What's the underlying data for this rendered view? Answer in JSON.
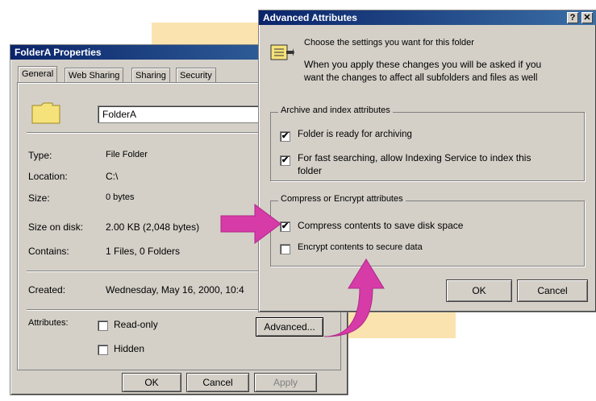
{
  "colors": {
    "arrow": "#d63ba8",
    "highlight_band": "#fbe3b0",
    "titlebar": "#0a246a"
  },
  "props": {
    "title": "FolderA Properties",
    "tabs": [
      "General",
      "Web Sharing",
      "Sharing",
      "Security"
    ],
    "folder_icon": "folder-icon",
    "name_value": "FolderA",
    "rows": [
      {
        "label": "Type:",
        "value": "File Folder"
      },
      {
        "label": "Location:",
        "value": "C:\\"
      },
      {
        "label": "Size:",
        "value": "0 bytes"
      },
      {
        "label": "Size on disk:",
        "value": "2.00 KB (2,048 bytes)"
      },
      {
        "label": "Contains:",
        "value": "1 Files, 0 Folders"
      }
    ],
    "created_label": "Created:",
    "created_value": "Wednesday, May 16, 2000, 10:4",
    "attributes_label": "Attributes:",
    "readonly_label": "Read-only",
    "hidden_label": "Hidden",
    "advanced_button": "Advanced...",
    "ok": "OK",
    "cancel": "Cancel",
    "apply": "Apply"
  },
  "adv": {
    "title": "Advanced Attributes",
    "help_icon": "help-icon",
    "close_icon": "close-icon",
    "intro_line1": "Choose the settings you want for this folder",
    "intro_line2": "When you apply these changes you will be asked if you",
    "intro_line3": "want the changes to affect all subfolders and files as well",
    "archive_group": "Archive and index attributes",
    "archive_label": "Folder is ready for archiving",
    "index_label_1": "For fast searching, allow Indexing Service to index this",
    "index_label_2": "folder",
    "compress_group": "Compress or Encrypt attributes",
    "compress_label": "Compress contents to save disk space",
    "encrypt_label": "Encrypt contents to secure data",
    "ok": "OK",
    "cancel": "Cancel"
  }
}
